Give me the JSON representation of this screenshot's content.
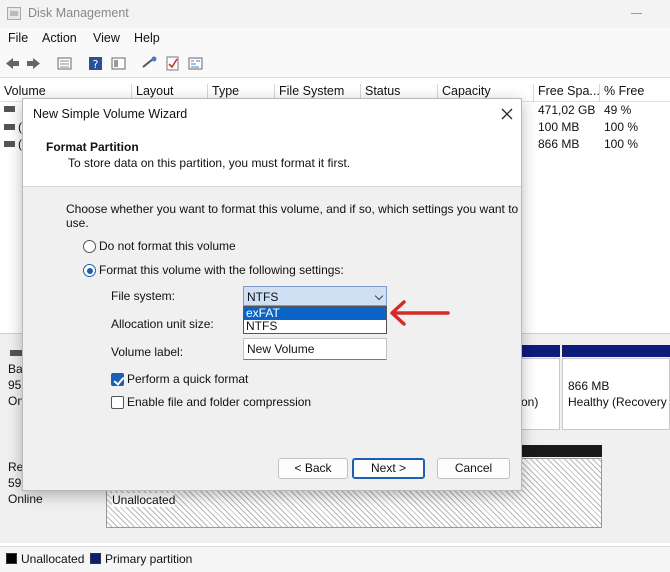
{
  "window": {
    "title": "Disk Management"
  },
  "menu": [
    "File",
    "Action",
    "View",
    "Help"
  ],
  "columns": [
    "Volume",
    "Layout",
    "Type",
    "File System",
    "Status",
    "Capacity",
    "Free Spa...",
    "% Free"
  ],
  "volumes": [
    {
      "free_space": "471,02 GB",
      "percent_free": "49 %"
    },
    {
      "prefix": "(",
      "free_space": "100 MB",
      "percent_free": "100 %"
    },
    {
      "prefix": "(",
      "free_space": "866 MB",
      "percent_free": "100 %"
    }
  ],
  "lower_pane": {
    "disk0": {
      "label_1": "Ba",
      "label_2": "95",
      "label_3": "On"
    },
    "disk1": {
      "label_1": "Re",
      "label_2": "59,",
      "label_3": "Online"
    },
    "recovery_partition": {
      "size": "866 MB",
      "status": "Healthy (Recovery P"
    },
    "partial_text": "on)",
    "unallocated_label": "Unallocated"
  },
  "legend": {
    "unallocated": "Unallocated",
    "primary": "Primary partition"
  },
  "colors": {
    "unallocated": "#000000",
    "primary": "#0d1b7a",
    "accent": "#1a5fb4",
    "arrow": "#d42a2a"
  },
  "dialog": {
    "title": "New Simple Volume Wizard",
    "header_title": "Format Partition",
    "header_subtitle": "To store data on this partition, you must format it first.",
    "prompt": "Choose whether you want to format this volume, and if so, which settings you want to use.",
    "radio_no_format": "Do not format this volume",
    "radio_format": "Format this volume with the following settings:",
    "file_system_label": "File system:",
    "file_system_value": "NTFS",
    "file_system_options": [
      "exFAT",
      "NTFS"
    ],
    "allocation_label": "Allocation unit size:",
    "volume_label_label": "Volume label:",
    "volume_label_value": "New Volume",
    "quick_format_label": "Perform a quick format",
    "compression_label": "Enable file and folder compression",
    "back_button": "< Back",
    "next_button": "Next >",
    "cancel_button": "Cancel"
  }
}
